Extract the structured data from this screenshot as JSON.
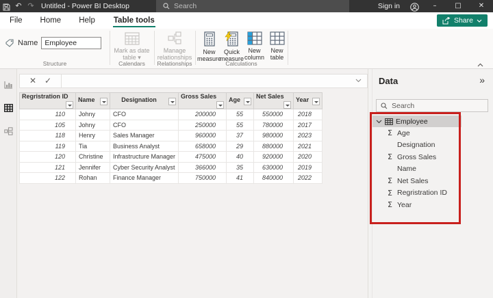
{
  "titlebar": {
    "title": "Untitled - Power BI Desktop",
    "search_placeholder": "Search",
    "sign_in_label": "Sign in"
  },
  "menubar": {
    "items": [
      "File",
      "Home",
      "Help"
    ],
    "active_tab": "Table tools",
    "share_label": "Share"
  },
  "ribbon": {
    "structure": {
      "name_label": "Name",
      "name_value": "Employee",
      "group_label": "Structure"
    },
    "calendars": {
      "button_label": "Mark as date table",
      "group_label": "Calendars"
    },
    "relationships": {
      "button_label": "Manage relationships",
      "group_label": "Relationships"
    },
    "calculations": {
      "group_label": "Calculations",
      "buttons": [
        {
          "label": "New measure",
          "icon": "new-measure-icon"
        },
        {
          "label": "Quick measure",
          "icon": "quick-measure-icon"
        },
        {
          "label": "New column",
          "icon": "new-column-icon"
        },
        {
          "label": "New table",
          "icon": "new-table-icon"
        }
      ]
    }
  },
  "table": {
    "columns": [
      "Regristration ID",
      "Name",
      "Designation",
      "Gross Sales",
      "Age",
      "Net Sales",
      "Year"
    ],
    "rows": [
      [
        "110",
        "Johny",
        "CFO",
        "200000",
        "55",
        "550000",
        "2018"
      ],
      [
        "105",
        "Johny",
        "CFO",
        "250000",
        "55",
        "780000",
        "2017"
      ],
      [
        "118",
        "Henry",
        "Sales Manager",
        "960000",
        "37",
        "980000",
        "2023"
      ],
      [
        "119",
        "Tia",
        "Business Analyst",
        "658000",
        "29",
        "880000",
        "2021"
      ],
      [
        "120",
        "Christine",
        "Infrastructure Manager",
        "475000",
        "40",
        "920000",
        "2020"
      ],
      [
        "121",
        "Jennifer",
        "Cyber Security Analyst",
        "366000",
        "35",
        "630000",
        "2019"
      ],
      [
        "122",
        "Rohan",
        "Finance Manager",
        "750000",
        "41",
        "840000",
        "2022"
      ]
    ]
  },
  "data_pane": {
    "title": "Data",
    "search_placeholder": "Search",
    "tree": {
      "table_name": "Employee",
      "fields": [
        {
          "label": "Age",
          "aggregate": true
        },
        {
          "label": "Designation",
          "aggregate": false
        },
        {
          "label": "Gross Sales",
          "aggregate": true
        },
        {
          "label": "Name",
          "aggregate": false
        },
        {
          "label": "Net Sales",
          "aggregate": true
        },
        {
          "label": "Regristration ID",
          "aggregate": true
        },
        {
          "label": "Year",
          "aggregate": true
        }
      ]
    }
  },
  "colors": {
    "accent_teal": "#12806b",
    "highlight_red": "#c8201d",
    "new_column_blue": "#29a0da",
    "quick_measure_yellow": "#f2c811"
  }
}
